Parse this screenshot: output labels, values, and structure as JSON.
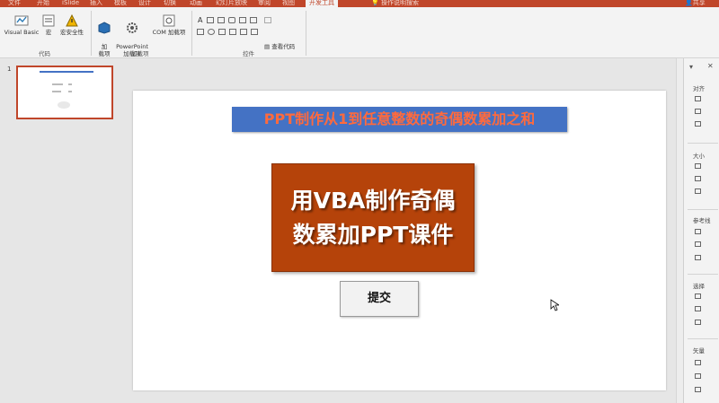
{
  "tabs": [
    {
      "label": "文件"
    },
    {
      "label": "开始"
    },
    {
      "label": "iSlide"
    },
    {
      "label": "插入"
    },
    {
      "label": "模板"
    },
    {
      "label": "设计"
    },
    {
      "label": "切换"
    },
    {
      "label": "动画"
    },
    {
      "label": "幻灯片放映"
    },
    {
      "label": "审阅"
    },
    {
      "label": "视图"
    },
    {
      "label": "开发工具"
    },
    {
      "label": "操作说明搜索"
    },
    {
      "label": "共享"
    }
  ],
  "ribbon": {
    "code_group": {
      "label": "代码",
      "visual_basic": "Visual Basic",
      "macros": "宏",
      "macro_security": "宏安全性"
    },
    "addins_group": {
      "label": "加载项",
      "addin": "加\n载项",
      "powerpoint_addin": "PowerPoint\n加载项",
      "com_addin": "COM 加载项"
    },
    "controls_group": {
      "label": "控件",
      "view_code": "查看代码"
    }
  },
  "thumbnail": {
    "number": "1"
  },
  "slide": {
    "title": "PPT制作从1到任意整数的奇偶数累加之和",
    "main_line1": "用VBA制作奇偶",
    "main_line2": "数累加PPT课件",
    "submit_label": "提交"
  },
  "format_pane": {
    "sections": [
      {
        "label": "对齐"
      },
      {
        "label": "大小"
      },
      {
        "label": "参考线"
      },
      {
        "label": "选择"
      },
      {
        "label": "矢量"
      }
    ]
  },
  "colors": {
    "accent": "#c0462a",
    "title_bg": "#4472c4",
    "title_text": "#ff6a3d",
    "box_bg": "#b5430a"
  }
}
